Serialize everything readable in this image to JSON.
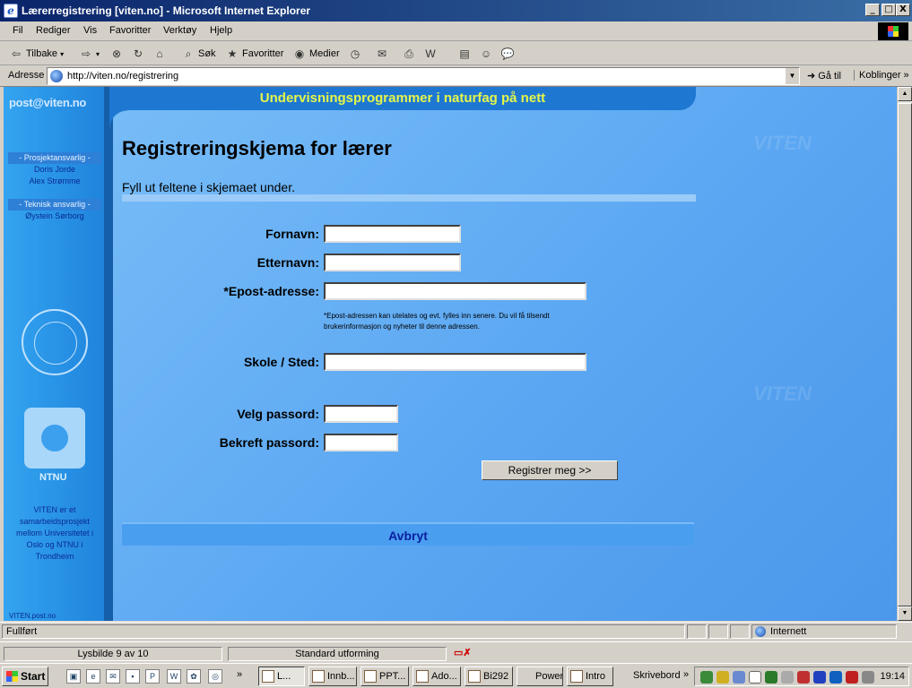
{
  "window": {
    "title": "Lærerregistrering [viten.no] - Microsoft Internet Explorer",
    "minimize": "_",
    "maximize": "□",
    "close": "X"
  },
  "menu": [
    "Fil",
    "Rediger",
    "Vis",
    "Favoritter",
    "Verktøy",
    "Hjelp"
  ],
  "toolbar": {
    "back": "Tilbake",
    "search": "Søk",
    "favorites": "Favoritter",
    "media": "Medier"
  },
  "address": {
    "label": "Adresse",
    "url": "http://viten.no/registrering",
    "go": "Gå til",
    "links": "Koblinger"
  },
  "page": {
    "banner": "Undervisningsprogrammer i naturfag på nett",
    "mail_logo": "post@viten.no",
    "sidebar": {
      "project_head": "- Prosjektansvarlig -",
      "project_names": [
        "Doris Jorde",
        "Alex Strømme"
      ],
      "tech_head": "- Teknisk ansvarlig -",
      "tech_name": "Øystein Sørborg",
      "ntnu": "NTNU",
      "viten_desc": "VITEN er et samarbeidsprosjekt mellom Universitetet i Oslo og NTNU i Trondheim",
      "footer": "VITEN.post.no"
    },
    "heading": "Registreringskjema for lærer",
    "intro": "Fyll ut feltene i skjemaet under.",
    "fields": {
      "first_name": "Fornavn:",
      "last_name": "Etternavn:",
      "email": "*Epost-adresse:",
      "school": "Skole / Sted:",
      "password": "Velg passord:",
      "confirm": "Bekreft passord:"
    },
    "email_note": "*Epost-adressen kan utelates og evt. fylles inn senere. Du vil få tilsendt brukerinformasjon og nyheter til denne adressen.",
    "submit": "Registrer meg >>",
    "cancel": "Avbryt",
    "watermark": "VITEN"
  },
  "status": {
    "text": "Fullført",
    "zone": "Internett"
  },
  "ppt": {
    "slide": "Lysbilde 9 av 10",
    "design": "Standard utforming"
  },
  "taskbar": {
    "start": "Start",
    "buttons": [
      "L...",
      "Innb...",
      "PPT...",
      "Ado...",
      "Bi292",
      "PowerP...",
      "Intro"
    ],
    "desktop": "Skrivebord",
    "clock": "19:14"
  }
}
